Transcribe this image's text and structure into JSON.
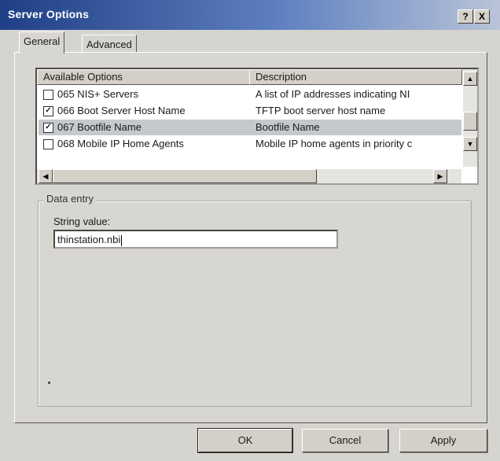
{
  "window": {
    "title": "Server Options",
    "help_label": "?",
    "close_label": "X"
  },
  "tabs": [
    {
      "label": "General"
    },
    {
      "label": "Advanced"
    }
  ],
  "options_list": {
    "columns": {
      "name": "Available Options",
      "description": "Description"
    },
    "rows": [
      {
        "checked": false,
        "name": "065 NIS+ Servers",
        "description": "A list of IP addresses indicating NI"
      },
      {
        "checked": true,
        "name": "066 Boot Server Host Name",
        "description": "TFTP boot server host name"
      },
      {
        "checked": true,
        "name": "067 Bootfile Name",
        "description": "Bootfile Name",
        "selected": true
      },
      {
        "checked": false,
        "name": "068 Mobile IP Home Agents",
        "description": "Mobile IP home agents in priority c"
      }
    ]
  },
  "data_entry": {
    "group_label": "Data entry",
    "field_label": "String value:",
    "value": "thinstation.nbi"
  },
  "buttons": {
    "ok": "OK",
    "cancel": "Cancel",
    "apply": "Apply"
  },
  "check_mark": "✓"
}
